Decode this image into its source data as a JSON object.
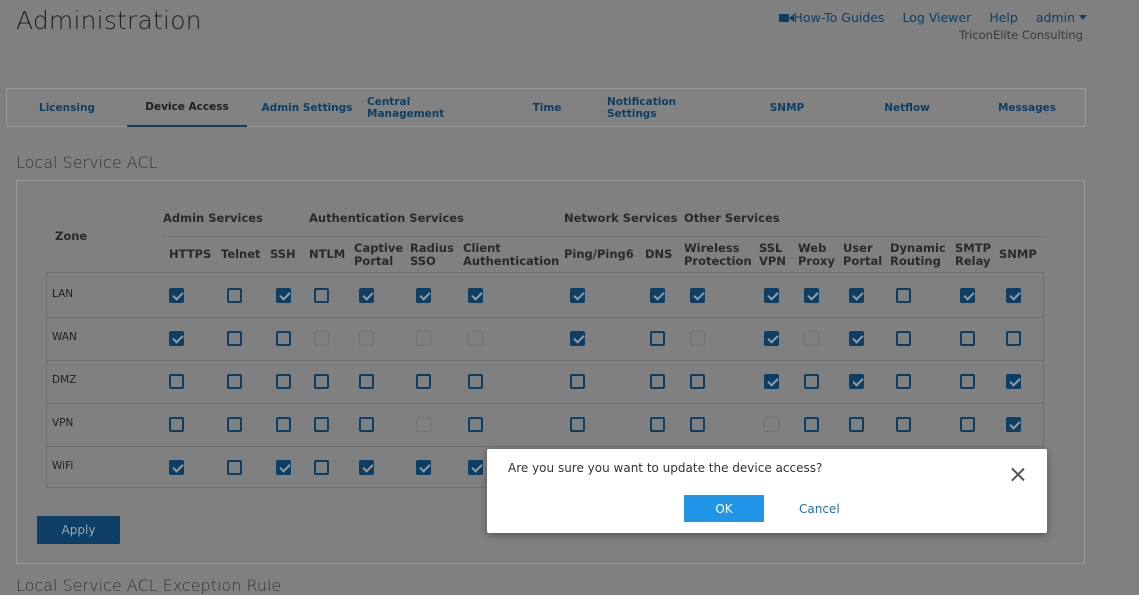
{
  "header": {
    "title": "Administration",
    "nav": {
      "howto": "How-To Guides",
      "logviewer": "Log Viewer",
      "help": "Help",
      "user": "admin"
    },
    "company": "TriconElite Consulting"
  },
  "tabs": [
    "Licensing",
    "Device Access",
    "Admin Settings",
    "Central Management",
    "Time",
    "Notification Settings",
    "SNMP",
    "Netflow",
    "Messages"
  ],
  "active_tab": "Device Access",
  "section": {
    "title": "Local Service ACL",
    "next_title": "Local Service ACL Exception Rule"
  },
  "table": {
    "zone_header": "Zone",
    "groups": [
      "Admin Services",
      "Authentication Services",
      "Network Services",
      "Other Services"
    ],
    "columns": [
      "HTTPS",
      "Telnet",
      "SSH",
      "NTLM",
      "Captive\nPortal",
      "Radius\nSSO",
      "Client\nAuthentication",
      "Ping/Ping6",
      "DNS",
      "Wireless\nProtection",
      "SSL\nVPN",
      "Web\nProxy",
      "User\nPortal",
      "Dynamic\nRouting",
      "SMTP\nRelay",
      "SNMP"
    ],
    "rows": [
      {
        "zone": "LAN",
        "states": [
          "c",
          "u",
          "c",
          "u",
          "c",
          "c",
          "c",
          "c",
          "c",
          "c",
          "c",
          "c",
          "c",
          "u",
          "c",
          "c"
        ]
      },
      {
        "zone": "WAN",
        "states": [
          "c",
          "u",
          "u",
          "d",
          "d",
          "d",
          "d",
          "c",
          "u",
          "d",
          "c",
          "d",
          "c",
          "u",
          "u",
          "u"
        ]
      },
      {
        "zone": "DMZ",
        "states": [
          "u",
          "u",
          "u",
          "u",
          "u",
          "u",
          "u",
          "u",
          "u",
          "u",
          "c",
          "u",
          "c",
          "u",
          "u",
          "c"
        ]
      },
      {
        "zone": "VPN",
        "states": [
          "u",
          "u",
          "u",
          "u",
          "u",
          "d",
          "u",
          "u",
          "u",
          "u",
          "d",
          "u",
          "u",
          "u",
          "u",
          "c"
        ]
      },
      {
        "zone": "WiFi",
        "states": [
          "c",
          "u",
          "c",
          "u",
          "c",
          "c",
          "c",
          "c",
          "c",
          "c",
          "c",
          "c",
          "c",
          "u",
          "c",
          "c"
        ]
      }
    ]
  },
  "apply_label": "Apply",
  "dialog": {
    "message": "Are you sure you want to update the device access?",
    "ok_label": "OK",
    "cancel_label": "Cancel"
  },
  "colors": {
    "accent": "#0d3f66",
    "ok_button": "#2196e9",
    "overlay": "#808080"
  }
}
